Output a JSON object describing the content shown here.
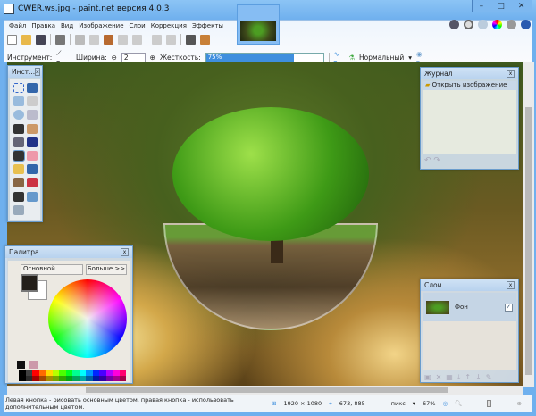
{
  "window": {
    "title": "CWER.ws.jpg - paint.net версия 4.0.3",
    "minimize": "–",
    "maximize": "□",
    "close": "✕"
  },
  "menu": [
    "Файл",
    "Правка",
    "Вид",
    "Изображение",
    "Слои",
    "Коррекция",
    "Эффекты"
  ],
  "toolbar_icons": [
    "new-icon",
    "open-icon",
    "save-icon",
    "print-icon",
    "cut-icon",
    "copy-icon",
    "paste-icon",
    "crop-icon",
    "deselect-icon",
    "undo-icon",
    "redo-icon",
    "grid-icon",
    "ruler-icon"
  ],
  "right_icons": [
    "tools-icon",
    "history-icon",
    "layers-icon",
    "colors-icon",
    "settings-icon",
    "help-icon"
  ],
  "options": {
    "tool_label": "Инструмент:",
    "width_label": "Ширина:",
    "width_value": "2",
    "hardness_label": "Жесткость:",
    "hardness_value": "75%",
    "hardness_fraction": 0.75,
    "blend_mode": "Нормальный"
  },
  "tools_panel": {
    "title": "Инст..."
  },
  "palette": {
    "title": "Палитра",
    "mode": "Основной",
    "more": "Больше >>",
    "primary": "#231f1a",
    "secondary": "#ffffff",
    "swatches": [
      "#000000",
      "#404040",
      "#ff0000",
      "#ff6a00",
      "#ffd800",
      "#b6ff00",
      "#4cff00",
      "#00ff21",
      "#00ff90",
      "#00ffff",
      "#0094ff",
      "#0026ff",
      "#4800ff",
      "#b200ff",
      "#ff00dc",
      "#ff006e"
    ]
  },
  "journal": {
    "title": "Журнал",
    "items": [
      "Открыть изображение"
    ]
  },
  "layers": {
    "title": "Слои",
    "items": [
      {
        "name": "Фон",
        "visible": true
      }
    ]
  },
  "status": {
    "hint": "Левая кнопка - рисовать основным цветом, правая кнопка - использовать дополнительным цветом.",
    "size": "1920 × 1080",
    "cursor": "673, 885",
    "units": "пикс",
    "zoom": "67%"
  },
  "colors": {
    "accent": "#3f8fde",
    "frame": "#6fb0ee"
  }
}
